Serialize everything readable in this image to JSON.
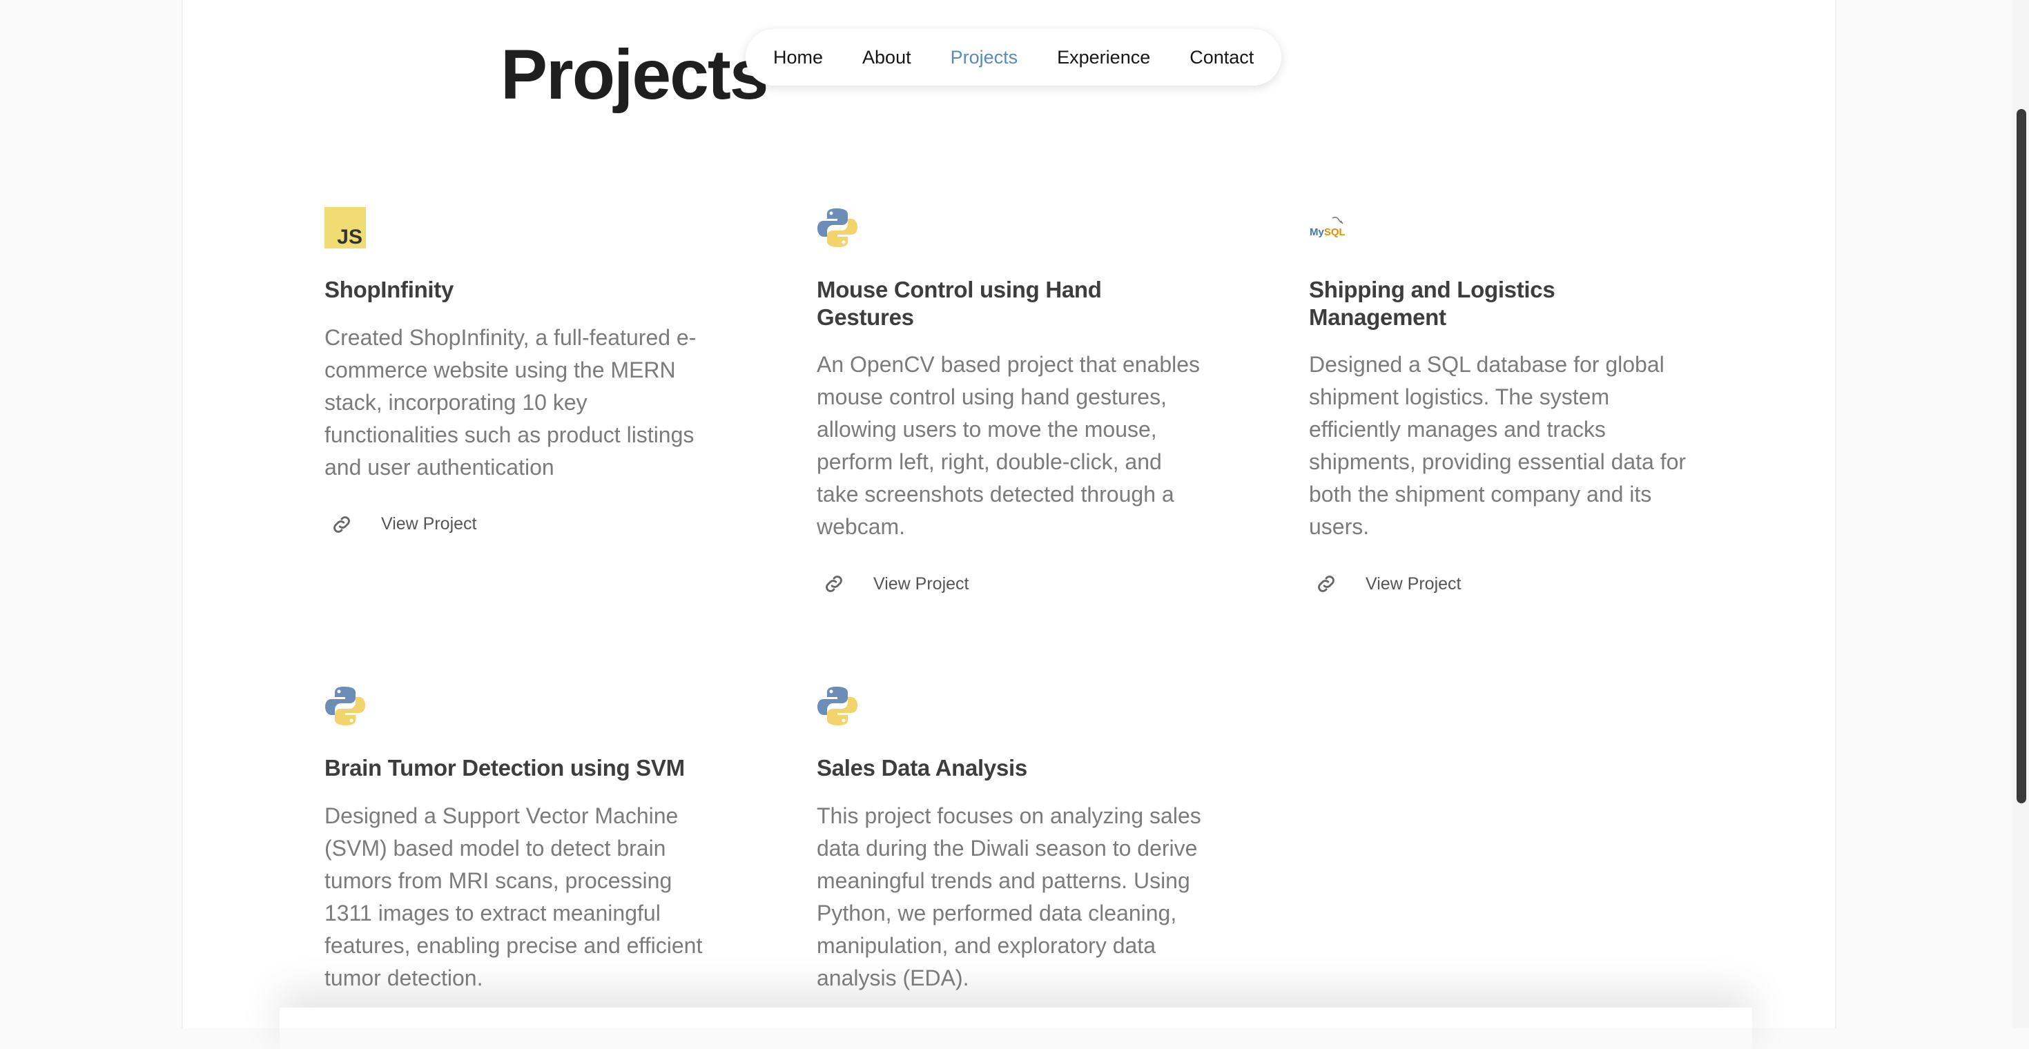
{
  "page": {
    "title": "Projects"
  },
  "nav": {
    "items": [
      {
        "label": "Home",
        "active": false
      },
      {
        "label": "About",
        "active": false
      },
      {
        "label": "Projects",
        "active": true
      },
      {
        "label": "Experience",
        "active": false
      },
      {
        "label": "Contact",
        "active": false
      }
    ]
  },
  "colors": {
    "accent": "#5a8ab5",
    "title": "#1f1f1f",
    "card_title": "#3d3d3d",
    "body_text": "#7b7b7b",
    "js_badge": "#f0dc73"
  },
  "projects": [
    {
      "icon": "javascript-icon",
      "title": "ShopInfinity",
      "description": "Created ShopInfinity, a full-featured e-commerce website using the MERN stack, incorporating 10 key functionalities such as product listings and user authentication",
      "link_label": "View Project"
    },
    {
      "icon": "python-icon",
      "title": "Mouse Control using Hand Gestures",
      "description": "An OpenCV based project that enables mouse control using hand gestures, allowing users to move the mouse, perform left, right, double-click, and take screenshots detected through a webcam.",
      "link_label": "View Project"
    },
    {
      "icon": "mysql-icon",
      "icon_text": "MySQL",
      "title": "Shipping and Logistics Management",
      "description": "Designed a SQL database for global shipment logistics. The system efficiently manages and tracks shipments, providing essential data for both the shipment company and its users.",
      "link_label": "View Project"
    },
    {
      "icon": "python-icon",
      "title": "Brain Tumor Detection using SVM",
      "description": "Designed a Support Vector Machine (SVM) based model to detect brain tumors from MRI scans, processing 1311 images to extract meaningful features, enabling precise and efficient tumor detection."
    },
    {
      "icon": "python-icon",
      "title": "Sales Data Analysis",
      "description": "This project focuses on analyzing sales data during the Diwali season to derive meaningful trends and patterns. Using Python, we performed data cleaning, manipulation, and exploratory data analysis (EDA)."
    }
  ]
}
